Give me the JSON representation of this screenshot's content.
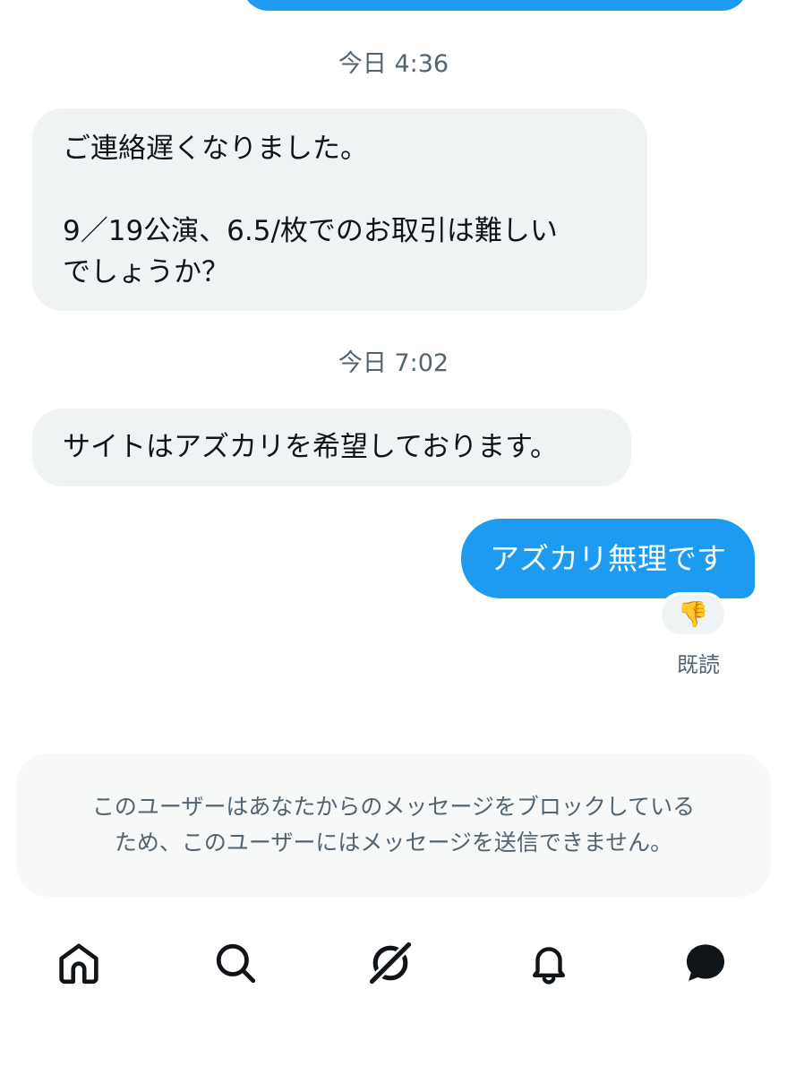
{
  "conversation": {
    "messages": [
      {
        "timestamp": "今日 4:36",
        "lines": [
          "ご連絡遅くなりました。",
          "",
          "9／19公演、6.5/枚でのお取引は難しい",
          "でしょうか？"
        ]
      },
      {
        "timestamp": "今日 7:02",
        "lines": [
          "サイトはアズカリを希望しております。"
        ]
      }
    ],
    "sent": {
      "text": "アズカリ無理です",
      "reaction": "👎",
      "read_receipt": "既読"
    }
  },
  "blocked_notice": {
    "lines": [
      "このユーザーはあなたからのメッセージをブロックしている",
      "ため、このユーザーにはメッセージを送信できません。"
    ]
  },
  "tabbar": {
    "items": [
      {
        "icon": "home-icon"
      },
      {
        "icon": "search-icon"
      },
      {
        "icon": "grok-icon"
      },
      {
        "icon": "bell-icon"
      },
      {
        "icon": "messages-icon"
      }
    ]
  },
  "colors": {
    "accent": "#1d9bf0",
    "incoming_bubble": "#eff3f4",
    "secondary_text": "#536471"
  }
}
